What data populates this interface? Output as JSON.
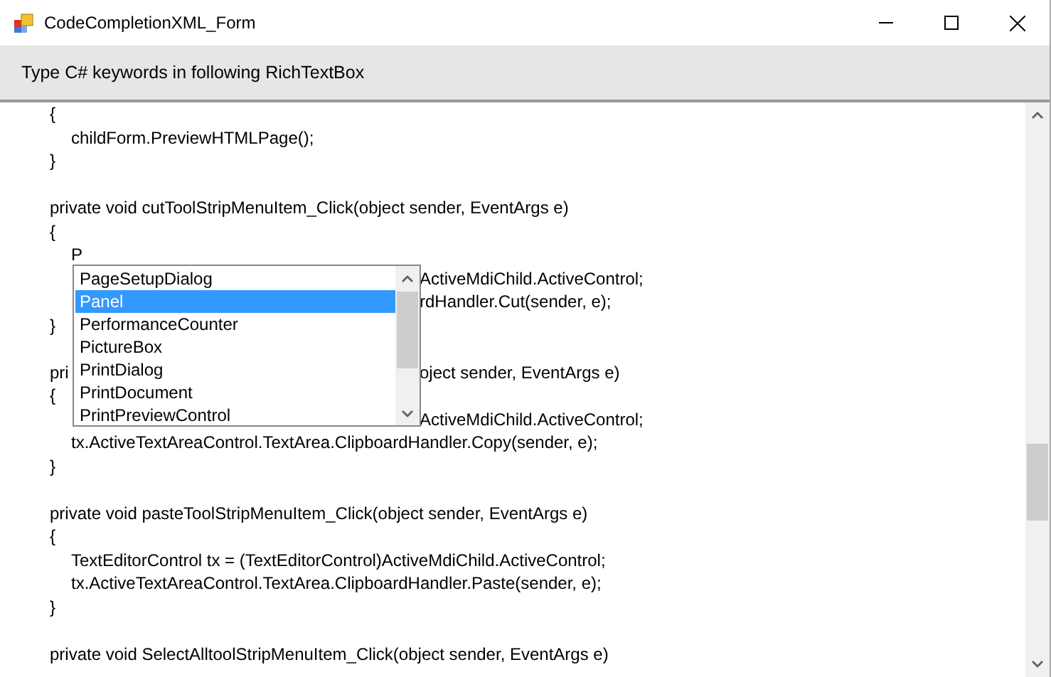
{
  "window": {
    "title": "CodeCompletionXML_Form"
  },
  "instruction": "Type C# keywords in following RichTextBox",
  "code_lines": [
    {
      "kind": "text",
      "text": "{"
    },
    {
      "kind": "indented",
      "text": "childForm.PreviewHTMLPage();"
    },
    {
      "kind": "text",
      "text": "}"
    },
    {
      "kind": "blank"
    },
    {
      "kind": "text",
      "text": "private void cutToolStripMenuItem_Click(object sender, EventArgs e)"
    },
    {
      "kind": "text",
      "text": "{"
    },
    {
      "kind": "indented",
      "text": "P"
    },
    {
      "kind": "covered",
      "suffix": "ActiveMdiChild.ActiveControl;"
    },
    {
      "kind": "covered",
      "suffix": "rdHandler.Cut(sender, e);"
    },
    {
      "kind": "text",
      "text": "}"
    },
    {
      "kind": "blank"
    },
    {
      "kind": "covered",
      "prefix": "pri",
      "suffix": "oject sender, EventArgs e)"
    },
    {
      "kind": "text",
      "text": "{"
    },
    {
      "kind": "covered",
      "suffix": "ActiveMdiChild.ActiveControl;"
    },
    {
      "kind": "indented",
      "text": "tx.ActiveTextAreaControl.TextArea.ClipboardHandler.Copy(sender, e);"
    },
    {
      "kind": "text",
      "text": "}"
    },
    {
      "kind": "blank"
    },
    {
      "kind": "text",
      "text": "private void pasteToolStripMenuItem_Click(object sender, EventArgs e)"
    },
    {
      "kind": "text",
      "text": "{"
    },
    {
      "kind": "indented",
      "text": "TextEditorControl tx = (TextEditorControl)ActiveMdiChild.ActiveControl;"
    },
    {
      "kind": "indented",
      "text": "tx.ActiveTextAreaControl.TextArea.ClipboardHandler.Paste(sender, e);"
    },
    {
      "kind": "text",
      "text": "}"
    },
    {
      "kind": "blank"
    },
    {
      "kind": "text",
      "text": "private void SelectAlltoolStripMenuItem_Click(object sender, EventArgs e)"
    }
  ],
  "completion_list": [
    {
      "label": "PageSetupDialog",
      "selected": false
    },
    {
      "label": "Panel",
      "selected": true
    },
    {
      "label": "PerformanceCounter",
      "selected": false
    },
    {
      "label": "PictureBox",
      "selected": false
    },
    {
      "label": "PrintDialog",
      "selected": false
    },
    {
      "label": "PrintDocument",
      "selected": false
    },
    {
      "label": "PrintPreviewControl",
      "selected": false
    }
  ]
}
